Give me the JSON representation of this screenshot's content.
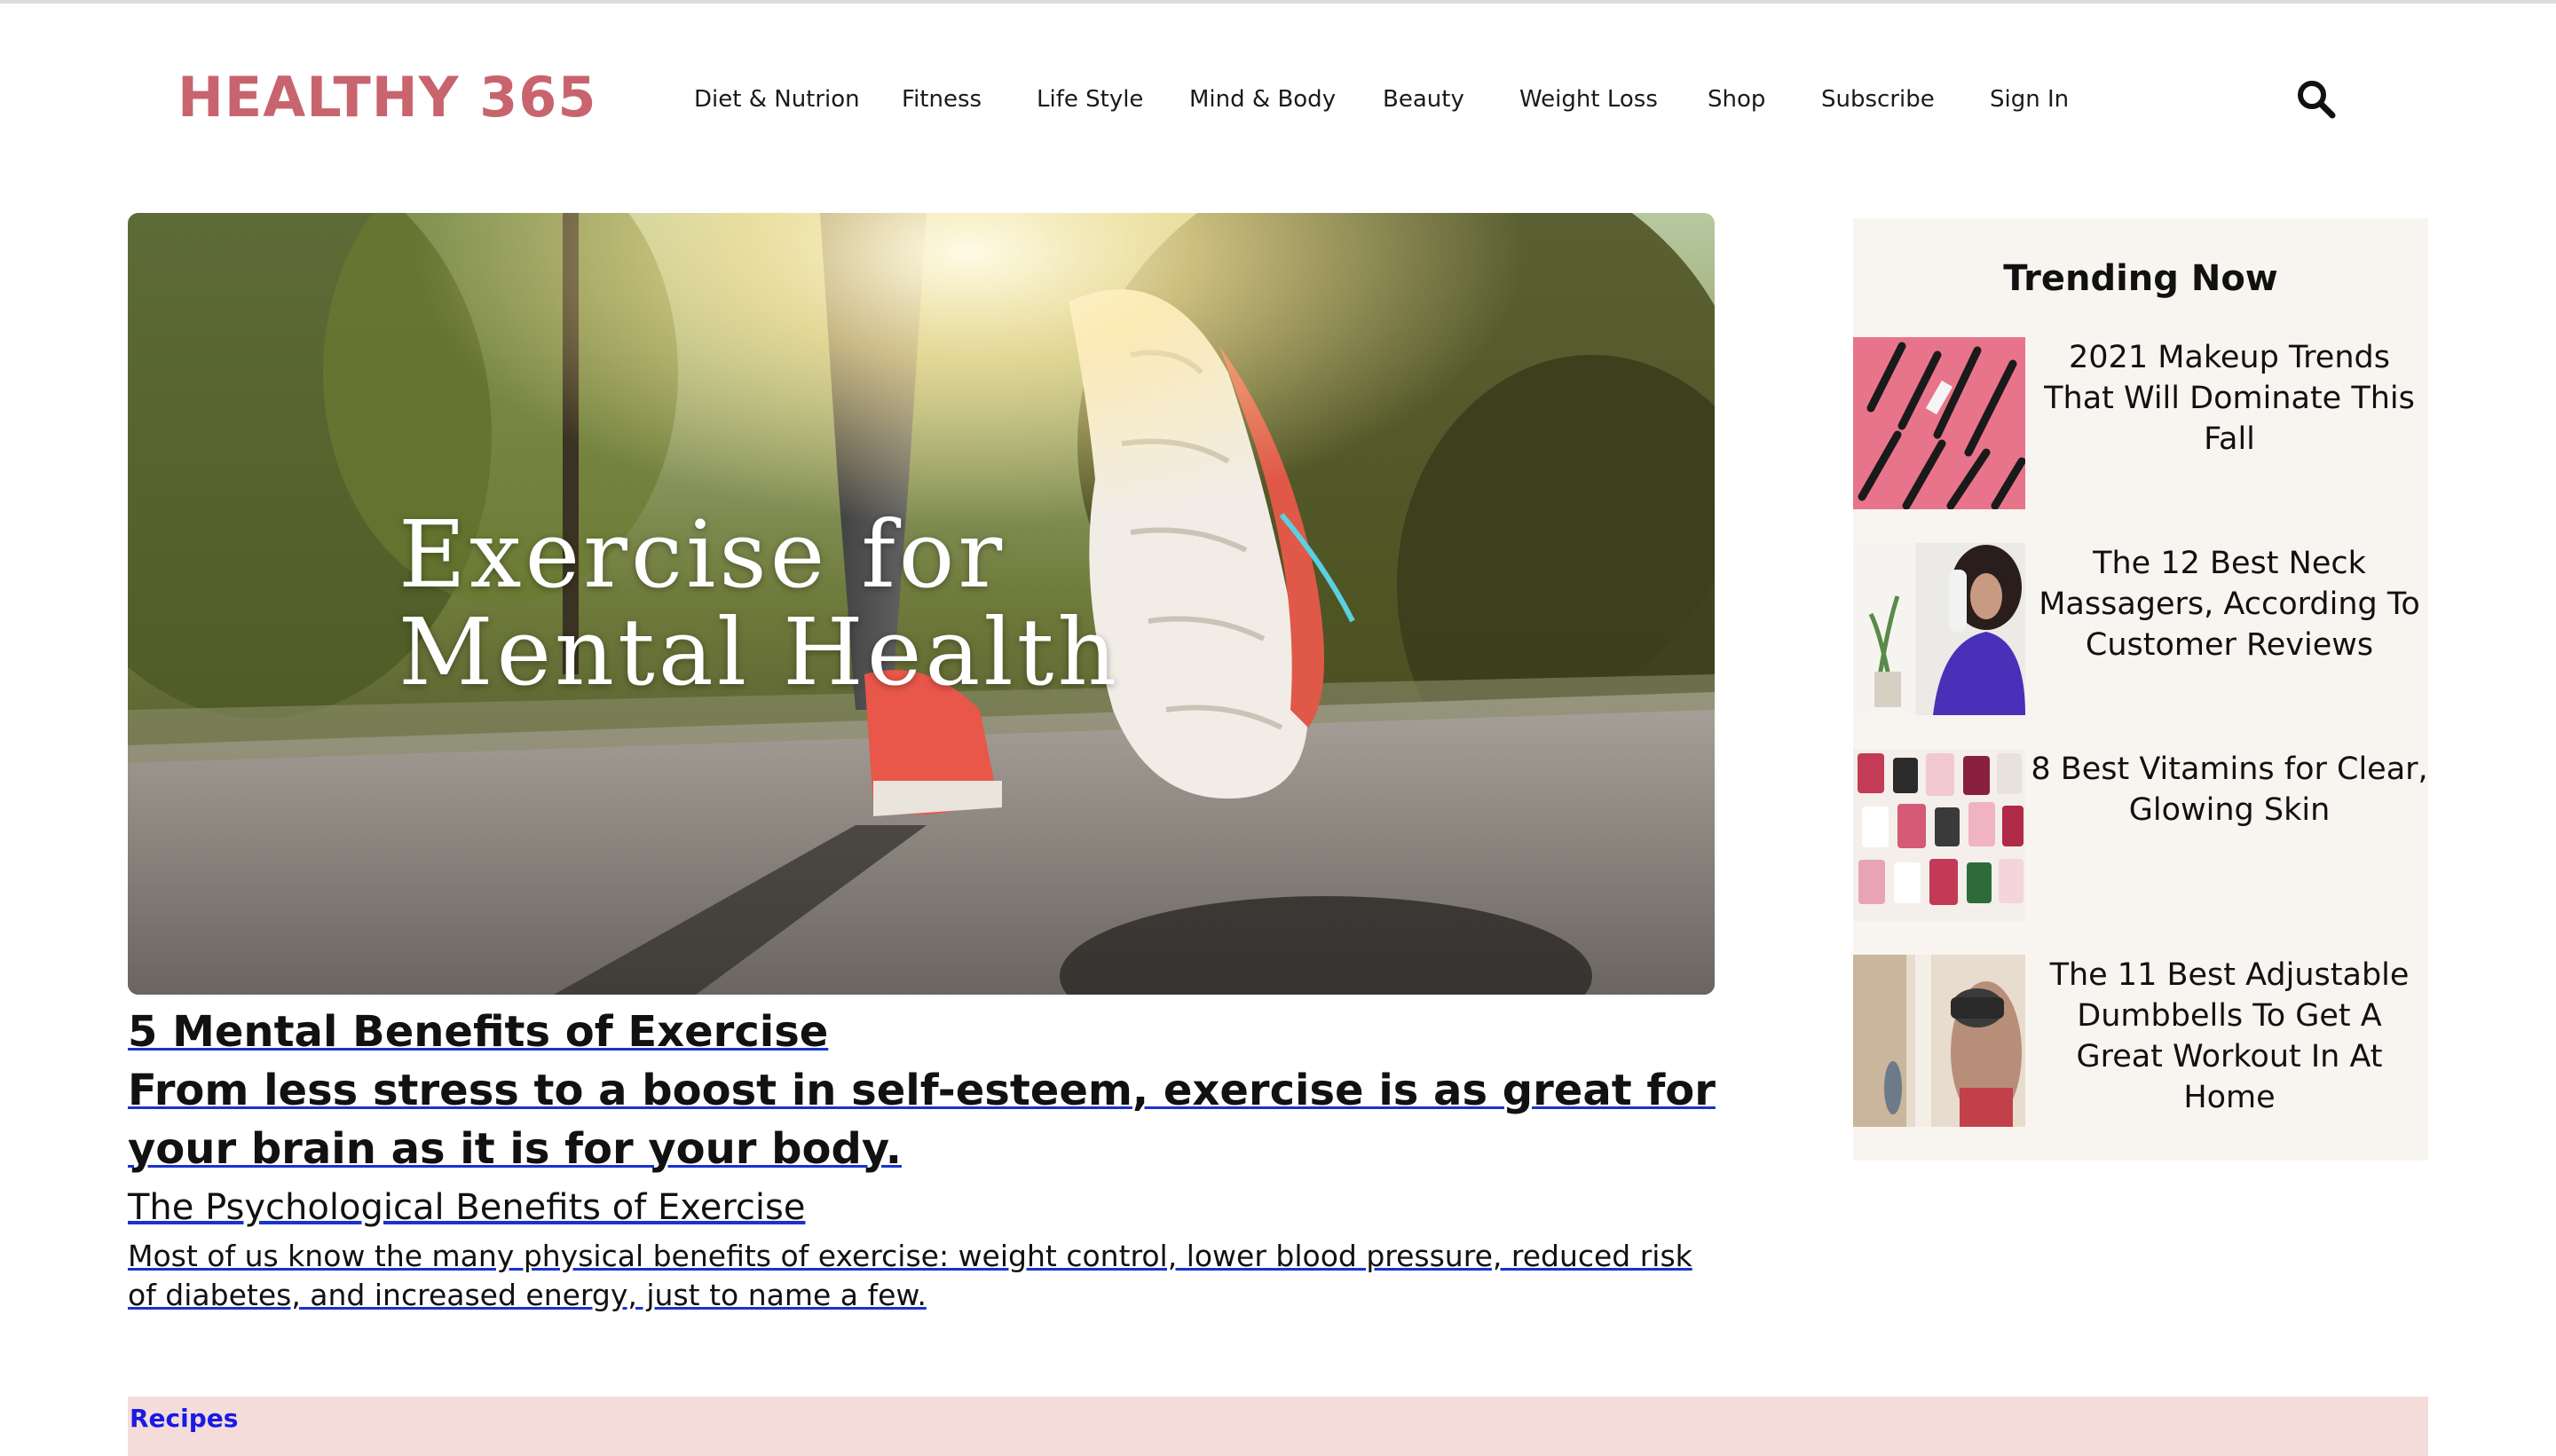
{
  "header": {
    "logo": "HEALTHY 365",
    "nav": [
      "Diet & Nutrion",
      "Fitness",
      "Life Style",
      "Mind & Body",
      "Beauty",
      "Weight Loss",
      "Shop",
      "Subscribe",
      "Sign In"
    ],
    "search_icon": "search-icon"
  },
  "hero": {
    "overlay_line1": "Exercise for",
    "overlay_line2": "Mental Health"
  },
  "article": {
    "title": "5 Mental Benefits of Exercise",
    "subtitle": "From less stress to a boost in self-esteem, exercise is as great for your brain as it is for your body.",
    "heading": "The Psychological Benefits of Exercise",
    "body": "Most of us know the many physical benefits of exercise: weight control, lower blood pressure, reduced risk of diabetes, and increased energy, just to name a few."
  },
  "sidebar": {
    "title": "Trending Now",
    "items": [
      {
        "text": "2021 Makeup Trends That Will Dominate This Fall"
      },
      {
        "text": "The 12 Best Neck Massagers, According To Customer Reviews"
      },
      {
        "text": "8 Best Vitamins for Clear, Glowing Skin"
      },
      {
        "text": "The 11 Best Adjustable Dumbbells To Get A Great Workout In At Home"
      }
    ]
  },
  "footer_bar": {
    "label": "Recipes"
  },
  "colors": {
    "logo": "#c8646e",
    "sidebar_bg": "#f8f5f0",
    "recipes_bg": "#f3dcd9",
    "link_underline": "#1a33cc",
    "recipes_text": "#1a1ae6"
  }
}
